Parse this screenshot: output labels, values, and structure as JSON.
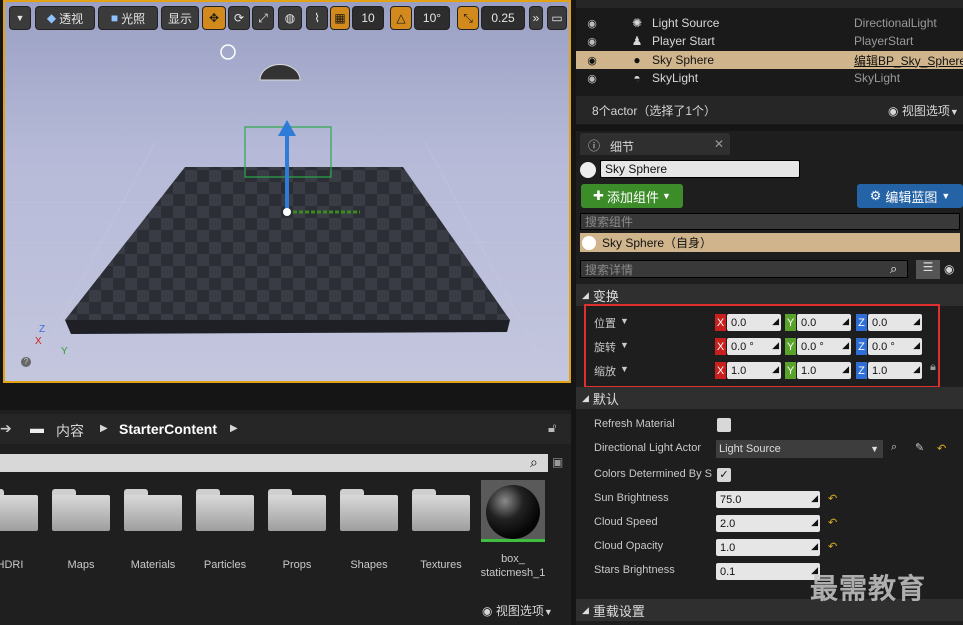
{
  "viewport": {
    "toolbar": {
      "perspective_label": "透视",
      "lit_label": "光照",
      "show_label": "显示",
      "grid_snap_value": "10",
      "rotation_snap_value": "10°",
      "scale_snap_value": "0.25"
    },
    "axis_labels": {
      "z": "Z",
      "x": "X",
      "y": "Y"
    }
  },
  "outliner": {
    "rows": [
      {
        "name": "Light Source",
        "type": "DirectionalLight",
        "icon": "sun-icon",
        "selected": false
      },
      {
        "name": "Player Start",
        "type": "PlayerStart",
        "icon": "player-start-icon",
        "selected": false
      },
      {
        "name": "Sky Sphere",
        "type": "编辑BP_Sky_Sphere",
        "icon": "sphere-icon",
        "selected": true
      },
      {
        "name": "SkyLight",
        "type": "SkyLight",
        "icon": "skylight-icon",
        "selected": false
      }
    ],
    "status": "8个actor（选择了1个）",
    "view_options": "视图选项"
  },
  "details": {
    "tab_label": "细节",
    "actor_name": "Sky Sphere",
    "add_component_label": "添加组件",
    "edit_blueprint_label": "编辑蓝图",
    "search_components_placeholder": "搜索组件",
    "component_self": "Sky Sphere（自身）",
    "search_details_placeholder": "搜索详情",
    "transform_section": "变换",
    "transform": [
      {
        "label": "位置",
        "x": "0.0",
        "y": "0.0",
        "z": "0.0"
      },
      {
        "label": "旋转",
        "x": "0.0 °",
        "y": "0.0 °",
        "z": "0.0 °"
      },
      {
        "label": "缩放",
        "x": "1.0",
        "y": "1.0",
        "z": "1.0"
      }
    ],
    "default_section": "默认",
    "properties": {
      "refresh_material": "Refresh Material",
      "directional_light_actor": "Directional Light Actor",
      "directional_light_value": "Light Source",
      "colors_determined": "Colors Determined By S",
      "sun_brightness": "Sun Brightness",
      "sun_brightness_value": "75.0",
      "cloud_speed": "Cloud Speed",
      "cloud_speed_value": "2.0",
      "cloud_opacity": "Cloud Opacity",
      "cloud_opacity_value": "1.0",
      "stars_brightness": "Stars Brightness",
      "stars_brightness_value": "0.1"
    },
    "rendering_section": "重载设置"
  },
  "content_browser": {
    "breadcrumb_root": "内容",
    "breadcrumb_folder": "StarterContent",
    "folders": [
      "HDRI",
      "Maps",
      "Materials",
      "Particles",
      "Props",
      "Shapes",
      "Textures"
    ],
    "asset_label_line1": "box_",
    "asset_label_line2": "staticmesh_1",
    "view_options": "视图选项"
  },
  "watermark": "最需教育",
  "colors": {
    "selection": "#d0b58c",
    "accent_orange": "#e2a214",
    "add_green": "#3c8d2a",
    "blueprint_blue": "#2463a6",
    "highlight_red": "#e02f2f"
  }
}
